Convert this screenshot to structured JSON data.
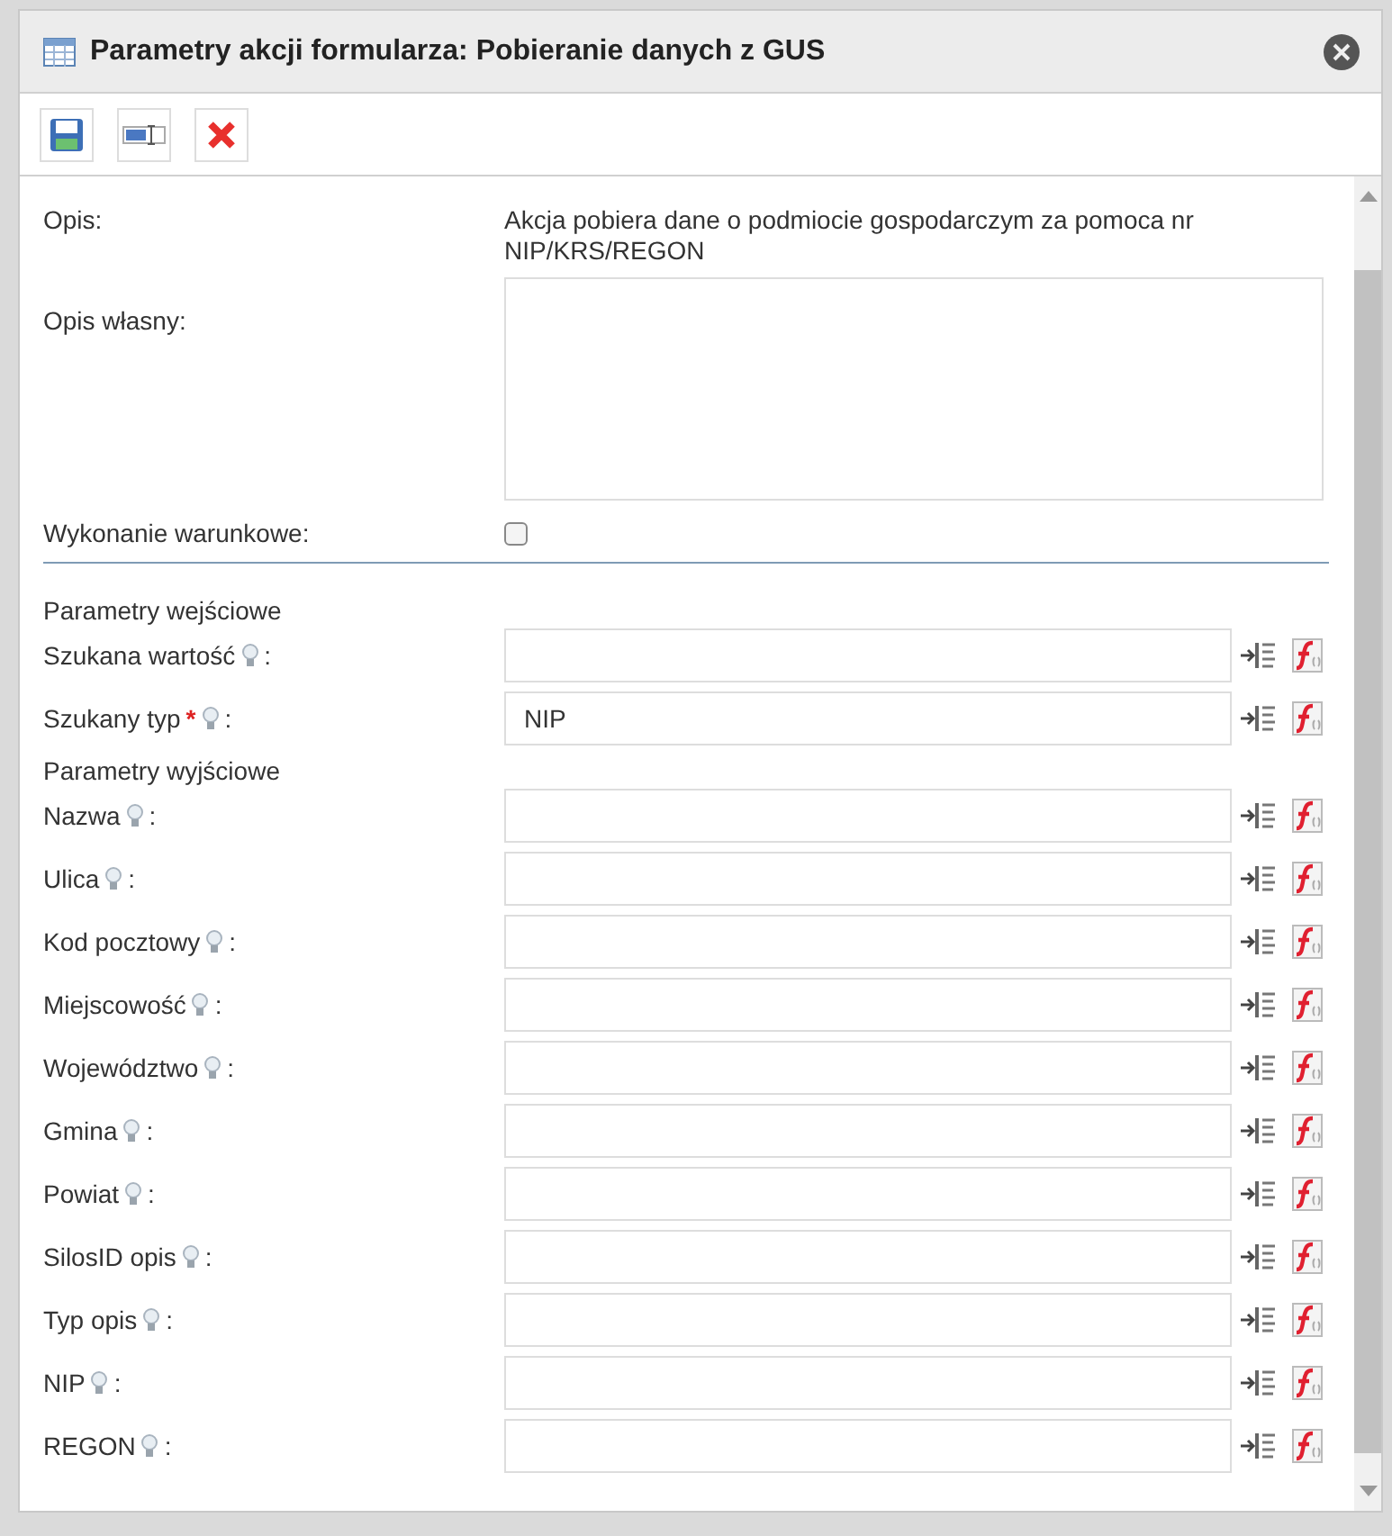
{
  "dialog": {
    "title": "Parametry akcji formularza: Pobieranie danych z GUS"
  },
  "description": {
    "label": "Opis:",
    "value": "Akcja pobiera dane o podmiocie gospodarczym za pomoca nr NIP/KRS/REGON"
  },
  "custom_description": {
    "label": "Opis własny:"
  },
  "conditional": {
    "label": "Wykonanie warunkowe:",
    "checked": false
  },
  "sections": [
    {
      "heading": "Parametry wejściowe",
      "params": [
        {
          "label": "Szukana wartość",
          "colon": ":"
        },
        {
          "label": "Szukany typ",
          "required_mark": "*",
          "colon": ":",
          "value": "NIP"
        }
      ]
    },
    {
      "heading": "Parametry wyjściowe",
      "params": [
        {
          "label": "Nazwa",
          "colon": ":"
        },
        {
          "label": "Ulica",
          "colon": ":"
        },
        {
          "label": "Kod pocztowy",
          "colon": ":"
        },
        {
          "label": "Miejscowość",
          "colon": ":"
        },
        {
          "label": "Województwo",
          "colon": ":"
        },
        {
          "label": "Gmina",
          "colon": ":"
        },
        {
          "label": "Powiat",
          "colon": ":"
        },
        {
          "label": "SilosID opis",
          "colon": ":"
        },
        {
          "label": "Typ opis",
          "colon": ":"
        },
        {
          "label": "NIP",
          "colon": ":"
        },
        {
          "label": "REGON",
          "colon": ":"
        }
      ]
    }
  ]
}
